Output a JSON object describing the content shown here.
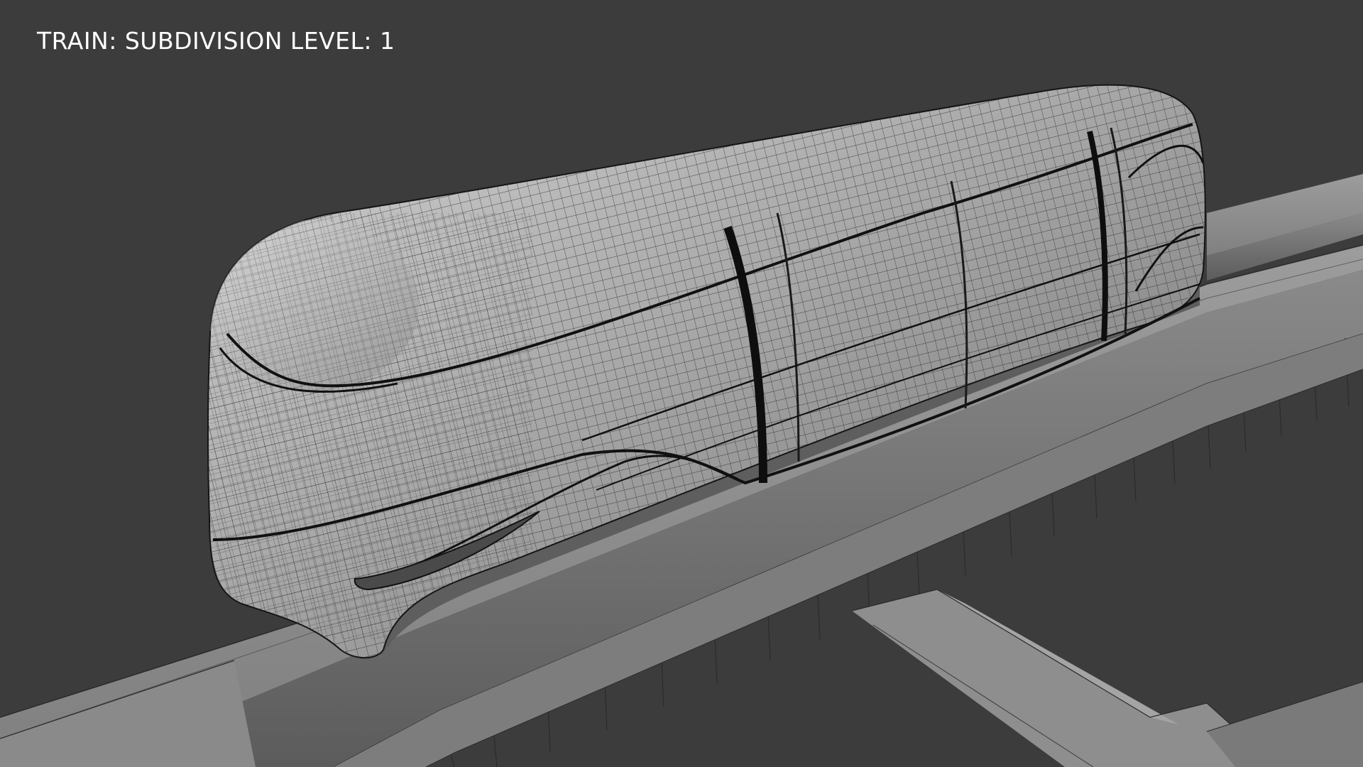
{
  "viewport": {
    "overlay_text": "TRAIN: SUBDIVISION LEVEL: 1",
    "background_color": "#3c3c3c"
  },
  "scene": {
    "subject": "monorail-train-wireframe",
    "colors": {
      "mesh_light": "#c9c9c9",
      "mesh_mid": "#9a9a9a",
      "mesh_dark": "#6e6e6e",
      "wire": "#1e1e1e",
      "beam": "#8f8f8f",
      "beam_side": "#7a7a7a"
    }
  }
}
